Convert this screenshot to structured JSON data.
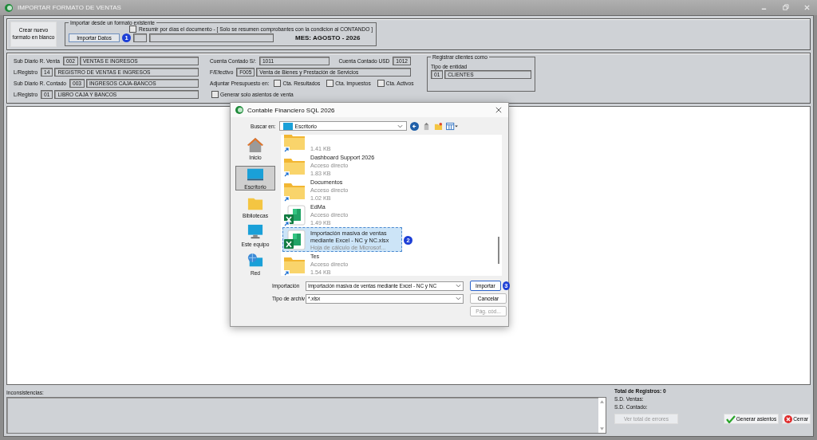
{
  "window": {
    "title": "IMPORTAR FORMATO DE VENTAS"
  },
  "create_button": "Crear nuevo formato en blanco",
  "import_group": {
    "legend": "Importar desde un formato existente",
    "summarize": {
      "label": "Resumir por días el documento - [ Solo se resumen comprobantes con la condicion al CONTANDO ]",
      "checked": false
    },
    "import_button": "Importar Datos",
    "badge": "1",
    "month": "MES: AGOSTO - 2026"
  },
  "journal_rows": [
    {
      "label": "Sub Diario R. Venta",
      "code": "002",
      "name": "VENTAS E INGRESOS"
    },
    {
      "label": "L/Registro",
      "code": "14",
      "name": "REGISTRO DE VENTAS E INGRESOS"
    },
    {
      "label": "Sub Diario R. Contado",
      "code": "003",
      "name": "INGRESOS CAJA-BANCOS"
    },
    {
      "label": "L/Registro",
      "code": "01",
      "name": "LIBRO CAJA Y BANCOS"
    }
  ],
  "accounts": {
    "cash_pen": {
      "label": "Cuenta Contado S/:",
      "value": "1011"
    },
    "cash_usd": {
      "label": "Cuenta Contado USD",
      "value": "1012"
    },
    "cash_flow": {
      "label": "F/Efectivo",
      "code": "F005",
      "name": "Venta de Bienes y Prestación de Servicios"
    }
  },
  "budget": {
    "label": "Adjuntar Presupuesto en:",
    "options": [
      {
        "label": "Cta. Resultados",
        "checked": false
      },
      {
        "label": "Cta. Impuestos",
        "checked": false
      },
      {
        "label": "Cta. Activos",
        "checked": false
      }
    ]
  },
  "only_sales": {
    "label": "Generar solo asientos de venta",
    "checked": false
  },
  "register_clients": {
    "legend": "Registrar clientes como",
    "entity_label": "Tipo de entidad",
    "code": "01",
    "name": "CLIENTES"
  },
  "dialog": {
    "title": "Contable Financiero SQL 2026",
    "look_in_label": "Buscar en:",
    "look_in_value": "Escritorio",
    "places": [
      {
        "label": "Inicio",
        "kind": "home",
        "selected": false
      },
      {
        "label": "Escritorio",
        "kind": "desktop",
        "selected": true
      },
      {
        "label": "Bibliotecas",
        "kind": "library",
        "selected": false
      },
      {
        "label": "Este equipo",
        "kind": "computer",
        "selected": false
      },
      {
        "label": "Red",
        "kind": "network",
        "selected": false
      }
    ],
    "files": [
      {
        "kind": "folder",
        "size": "1.41 KB",
        "selected": false
      },
      {
        "kind": "folder",
        "name": "Dashboard Support 2026",
        "desc": "Acceso directo",
        "size": "1.83 KB",
        "selected": false
      },
      {
        "kind": "folder",
        "name": "Documentos",
        "desc": "Acceso directo",
        "size": "1.02 KB",
        "selected": false
      },
      {
        "kind": "excel-shortcut",
        "name": "EdMa",
        "desc": "Acceso directo",
        "size": "1.49 KB",
        "selected": false
      },
      {
        "kind": "excel",
        "name": "Importación masiva de ventas mediante Excel - NC y NC.xlsx",
        "desc": "Hoja de cálculo de Microsof...",
        "selected": true,
        "badge": "2"
      },
      {
        "kind": "folder",
        "name": "Tes",
        "desc": "Acceso directo",
        "size": "1.54 KB",
        "selected": false
      }
    ],
    "filename_label": "Importación",
    "filename_value": "Importación masiva de ventas mediante Excel - NC y NC",
    "type_label": "Tipo de archiv",
    "type_value": "*.xlsx",
    "import_button": "Importar",
    "import_badge": "3",
    "cancel_button": "Cancelar",
    "codepage_button": {
      "label": "Pág. cód...",
      "disabled": true
    }
  },
  "inconsistencies_label": "Inconsistencias:",
  "totals": {
    "records": "Total de Registros: 0",
    "sales": "S.D. Ventas:",
    "cash": "S.D. Contado:"
  },
  "errors_button": {
    "label": "Ver total de errores",
    "disabled": true
  },
  "generate_button": "Generar asientos",
  "close_button": "Cerrar"
}
